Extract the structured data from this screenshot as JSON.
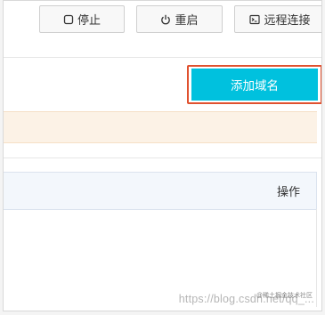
{
  "toolbar": {
    "stop": {
      "label": "停止",
      "icon": "stop-icon"
    },
    "restart": {
      "label": "重启",
      "icon": "power-icon"
    },
    "remote": {
      "label": "远程连接",
      "icon": "terminal-icon"
    }
  },
  "actions": {
    "add_domain_label": "添加域名"
  },
  "table": {
    "columns": {
      "operations": "操作"
    }
  },
  "watermark": {
    "url": "https://blog.csdn.net/qq_...",
    "brand": "@稀土掘金技术社区"
  },
  "colors": {
    "primary": "#00c1de",
    "highlight": "#e0512f",
    "notice_bg": "#fcf2e6",
    "table_header_bg": "#f3f7fc"
  }
}
